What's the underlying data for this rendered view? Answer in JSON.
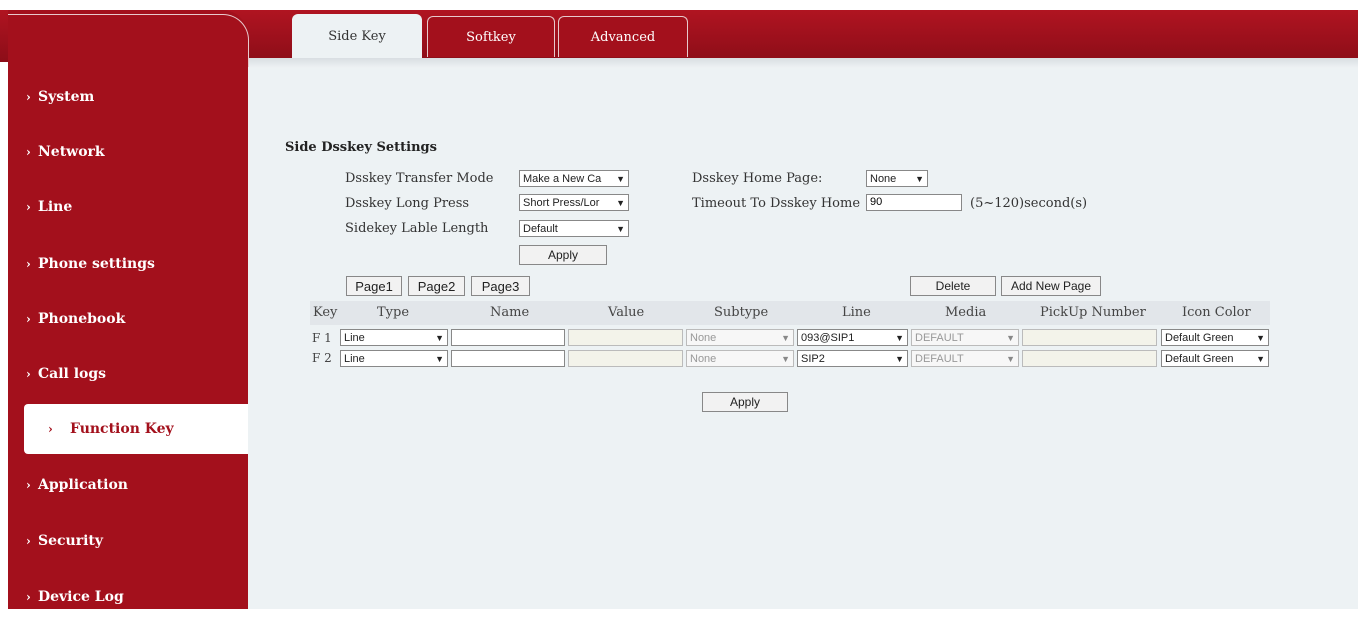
{
  "sidebar": {
    "items": [
      {
        "label": "System"
      },
      {
        "label": "Network"
      },
      {
        "label": "Line"
      },
      {
        "label": "Phone settings"
      },
      {
        "label": "Phonebook"
      },
      {
        "label": "Call logs"
      },
      {
        "label": "Function Key",
        "active": true
      },
      {
        "label": "Application"
      },
      {
        "label": "Security"
      },
      {
        "label": "Device Log"
      }
    ],
    "chevron": "›"
  },
  "tabs": [
    "Side Key",
    "Softkey",
    "Advanced"
  ],
  "settings": {
    "title": "Side Dsskey Settings",
    "transfer_mode_label": "Dsskey Transfer Mode",
    "transfer_mode_value": "Make a New Ca",
    "long_press_label": "Dsskey Long Press",
    "long_press_value": "Short Press/Lor",
    "lable_length_label": "Sidekey Lable Length",
    "lable_length_value": "Default",
    "home_page_label": "Dsskey Home Page:",
    "home_page_value": "None",
    "timeout_label": "Timeout To Dsskey Home",
    "timeout_value": "90",
    "timeout_hint": "(5~120)second(s)",
    "apply_label": "Apply"
  },
  "pages": [
    "Page1",
    "Page2",
    "Page3"
  ],
  "page_actions": {
    "delete": "Delete",
    "add": "Add New Page"
  },
  "table": {
    "headers": [
      "Key",
      "Type",
      "Name",
      "Value",
      "Subtype",
      "Line",
      "Media",
      "PickUp Number",
      "Icon Color"
    ],
    "rows": [
      {
        "key": "F 1",
        "type": "Line",
        "name": "",
        "value": "",
        "subtype": "None",
        "line": "093@SIP1",
        "media": "DEFAULT",
        "pickup": "",
        "icon_color": "Default Green"
      },
      {
        "key": "F 2",
        "type": "Line",
        "name": "",
        "value": "",
        "subtype": "None",
        "line": "SIP2",
        "media": "DEFAULT",
        "pickup": "",
        "icon_color": "Default Green"
      }
    ]
  },
  "bottom_apply": "Apply",
  "colors": {
    "brand": "#a3101c",
    "background": "#edf2f4"
  }
}
